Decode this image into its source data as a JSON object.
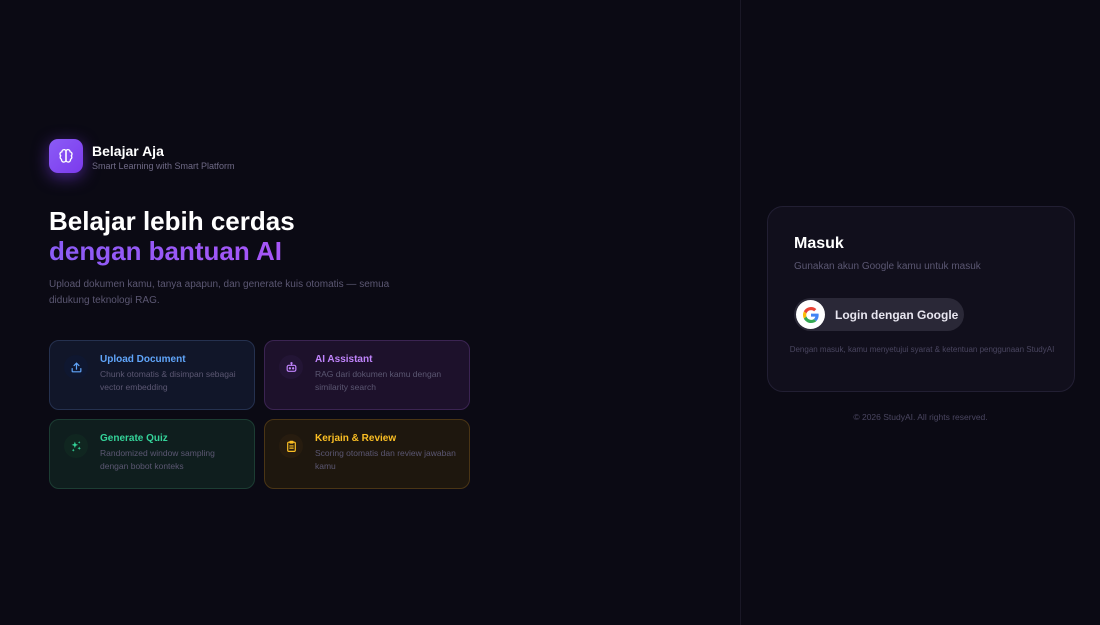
{
  "brand": {
    "name": "Belajar Aja",
    "tagline": "Smart Learning with Smart Platform",
    "logo_icon": "brain-icon"
  },
  "hero": {
    "line1": "Belajar lebih cerdas",
    "line2": "dengan bantuan AI",
    "subtitle": "Upload dokumen kamu, tanya apapun, dan generate kuis otomatis — semua didukung teknologi RAG."
  },
  "features": [
    {
      "title": "Upload Document",
      "desc": "Chunk otomatis & disimpan sebagai vector embedding",
      "icon": "upload-icon",
      "color": "#60a5fa"
    },
    {
      "title": "AI Assistant",
      "desc": "RAG dari dokumen kamu dengan similarity search",
      "icon": "robot-icon",
      "color": "#c084fc"
    },
    {
      "title": "Generate Quiz",
      "desc": "Randomized window sampling dengan bobot konteks",
      "icon": "sparkles-icon",
      "color": "#34d399"
    },
    {
      "title": "Kerjain & Review",
      "desc": "Scoring otomatis dan review jawaban kamu",
      "icon": "clipboard-icon",
      "color": "#fbbf24"
    }
  ],
  "login": {
    "title": "Masuk",
    "subtitle": "Gunakan akun Google kamu untuk masuk",
    "google_button": "Login dengan Google",
    "terms": "Dengan masuk, kamu menyetujui syarat & ketentuan penggunaan StudyAI"
  },
  "footer": {
    "copyright": "© 2026 StudyAI. All rights reserved."
  },
  "colors": {
    "background": "#0b0a14",
    "accent": "#8b5cf6"
  }
}
